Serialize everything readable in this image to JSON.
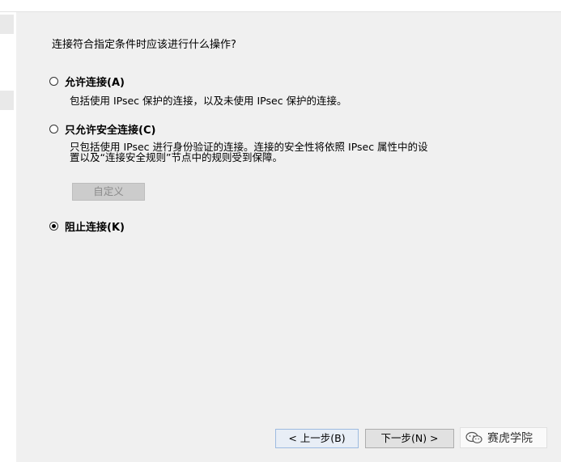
{
  "question": "连接符合指定条件时应该进行什么操作?",
  "options": [
    {
      "label": "允许连接(A)",
      "selected": false,
      "description": [
        "包括使用 IPsec 保护的连接，以及未使用 IPsec 保护的连接。"
      ]
    },
    {
      "label": "只允许安全连接(C)",
      "selected": false,
      "description": [
        "只包括使用 IPsec 进行身份验证的连接。连接的安全性将依照 IPsec 属性中的设",
        "置以及“连接安全规则”节点中的规则受到保障。"
      ]
    },
    {
      "label": "阻止连接(K)",
      "selected": true,
      "description": []
    }
  ],
  "customize_button": "自定义",
  "buttons": {
    "back": "< 上一步(B)",
    "next": "下一步(N) >"
  },
  "watermark": {
    "icon": "wechat-icon",
    "text": "赛虎学院"
  }
}
